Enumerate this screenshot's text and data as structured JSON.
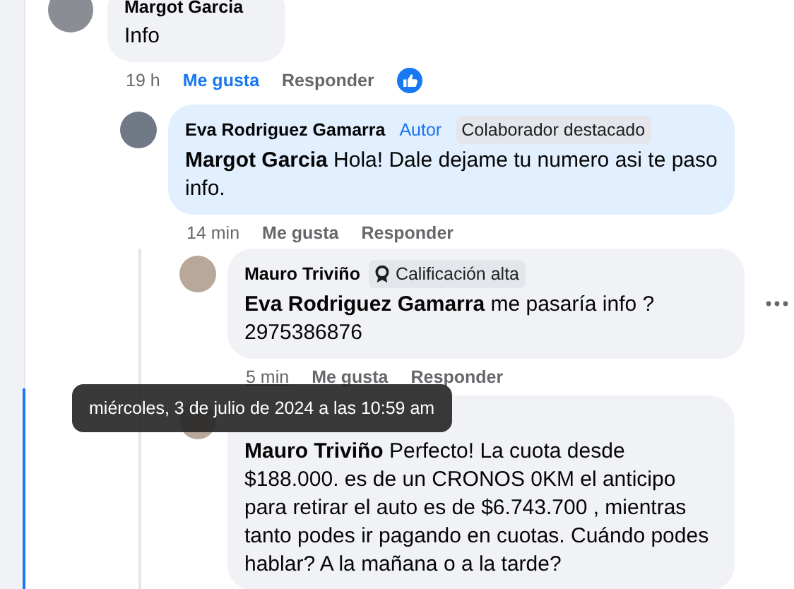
{
  "comments": [
    {
      "author": "Margot Garcia",
      "text": "Info",
      "highlighted": false,
      "time": "19 h",
      "time_hovered": false,
      "like": {
        "label": "Me gusta",
        "selected": true
      },
      "reply": "Responder",
      "has_reaction": true,
      "has_menu": false,
      "children": [
        {
          "author": "Eva Rodriguez Gamarra",
          "badges": [
            {
              "kind": "author",
              "label": "Autor"
            },
            {
              "kind": "badge",
              "label": "Colaborador destacado"
            }
          ],
          "text": "**Margot Garcia** Hola! Dale dejame tu numero asi te paso info.",
          "highlighted": true,
          "time": "14 min",
          "time_hovered": false,
          "like": {
            "label": "Me gusta",
            "selected": false
          },
          "reply": "Responder",
          "has_reaction": false,
          "has_menu": false,
          "children": [
            {
              "author": "Mauro Triviño",
              "badges": [
                {
                  "kind": "rating",
                  "label": "Calificación alta"
                }
              ],
              "text": "**Eva Rodriguez Gamarra** me pasaría info ?\n2975386876",
              "highlighted": false,
              "time": "5 min",
              "time_hovered": true,
              "like": {
                "label": "Me gusta",
                "selected": false
              },
              "reply": "Responder",
              "has_reaction": false,
              "has_menu": true
            },
            {
              "text": "**Mauro Triviño** Perfecto! La cuota desde $188.000. es de un CRONOS 0KM el anticipo para retirar el auto es de $6.743.700 , mientras tanto podes ir pagando en cuotas. Cuándo podes hablar? A la mañana o a la tarde?",
              "highlighted": false,
              "has_menu": false
            }
          ]
        }
      ]
    }
  ],
  "tooltip": {
    "text": "miércoles, 3 de julio de 2024 a las 10:59 am"
  }
}
